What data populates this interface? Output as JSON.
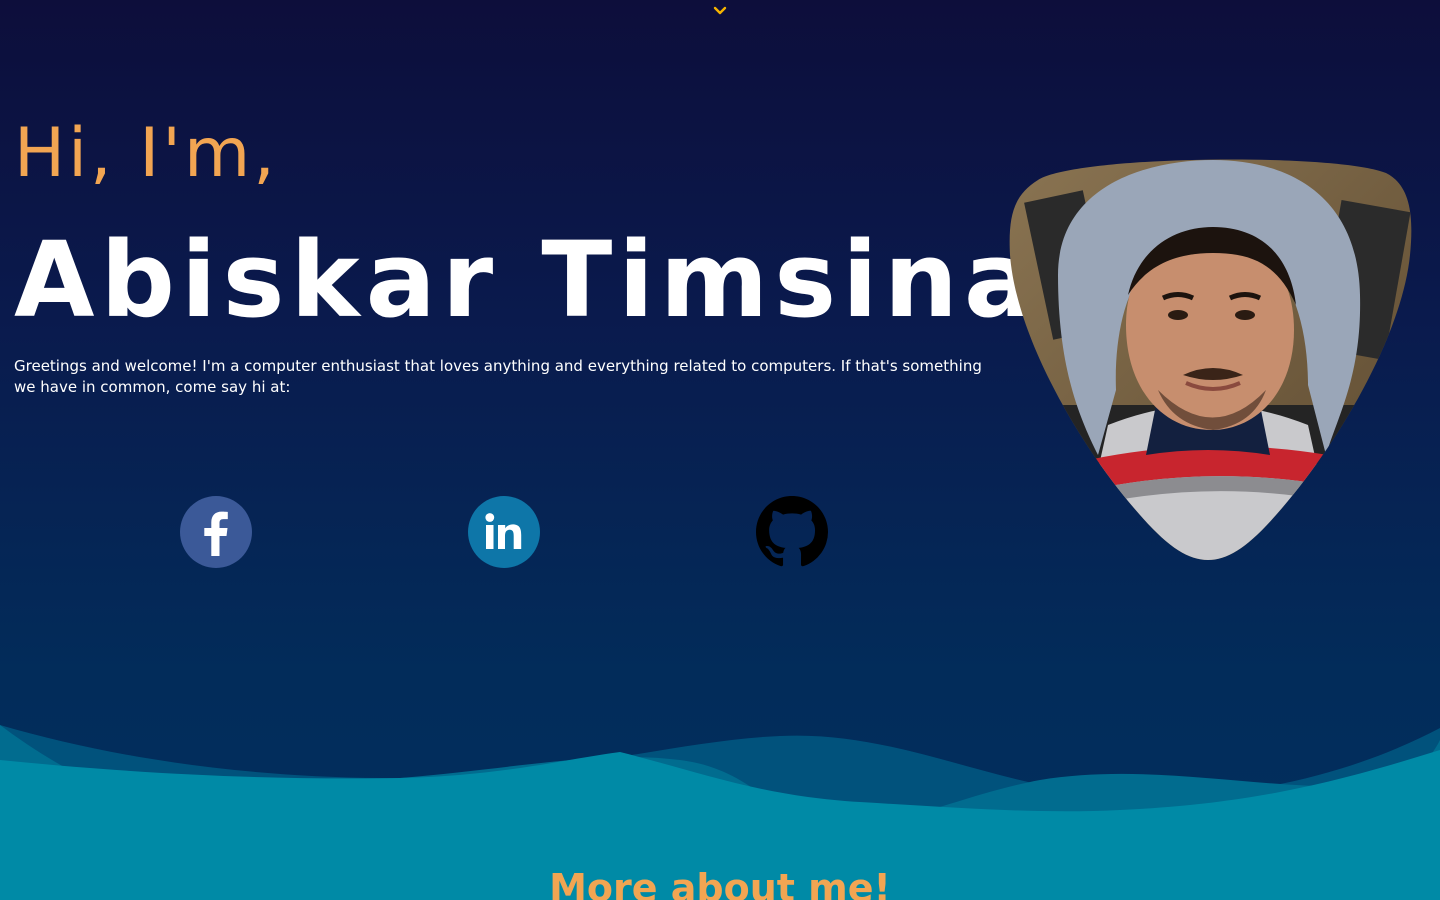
{
  "hero": {
    "greeting": "Hi, I'm,",
    "name": "Abiskar Timsina",
    "intro": "Greetings and welcome! I'm a computer enthusiast that loves anything and everything related to computers. If that's something we have in common, come say hi at:"
  },
  "social": [
    {
      "label": "Facebook",
      "icon": "facebook-icon"
    },
    {
      "label": "LinkedIn",
      "icon": "linkedin-icon"
    },
    {
      "label": "GitHub",
      "icon": "github-icon"
    }
  ],
  "sections": {
    "more_title": "More about me!"
  },
  "colors": {
    "accent": "#f2a552",
    "background_top": "#0d0e3b",
    "background_bottom": "#012f5f",
    "wave": "#008aa6",
    "facebook": "#3b5998",
    "linkedin": "#0e76a8",
    "github": "#000000",
    "chevron": "#f5b400"
  }
}
